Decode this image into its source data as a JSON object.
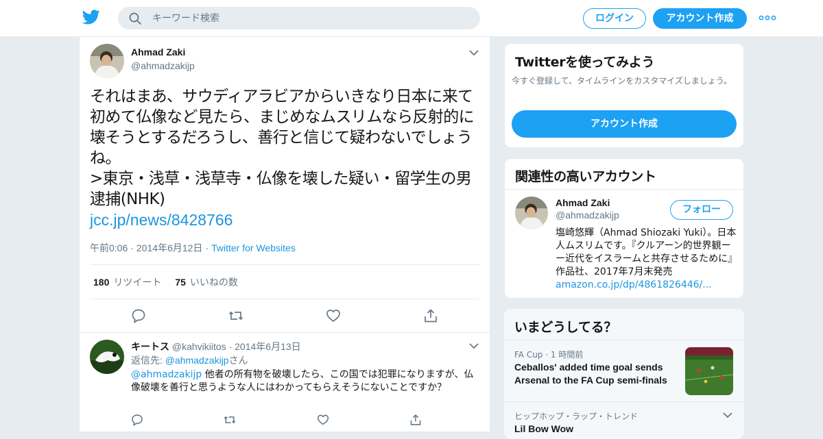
{
  "header": {
    "search_placeholder": "キーワード検索",
    "login_label": "ログイン",
    "signup_label": "アカウント作成"
  },
  "tweet": {
    "author_name": "Ahmad Zaki",
    "author_handle": "@ahmadzakijp",
    "text": "それはまあ、サウディアラビアからいきなり日本に来て初めて仏像など見たら、まじめなムスリムなら反射的に壊そうとするだろうし、善行と信じて疑わないでしょうね。\n>東京・浅草・浅草寺・仏像を壊した疑い・留学生の男逮捕(NHK)",
    "link": "jcc.jp/news/8428766",
    "time": "午前0:06",
    "date": "2014年6月12日",
    "source": "Twitter for Websites",
    "retweet_count": "180",
    "retweet_label": "リツイート",
    "like_count": "75",
    "like_label": "いいねの数"
  },
  "reply": {
    "author_name": "キートス",
    "author_handle": "@kahvikiitos",
    "date": "2014年6月13日",
    "reply_to_label": "返信先:",
    "reply_to_handle": "@ahmadzakijp",
    "reply_to_suffix": "さん",
    "mention": "@ahmadzakijp",
    "text": "他者の所有物を破壊したら、この国では犯罪になりますが、仏像破壊を善行と思うような人にはわかってもらえそうにないことですか？"
  },
  "signup_card": {
    "title": "Twitterを使ってみよう",
    "subtitle": "今すぐ登録して、タイムラインをカスタマイズしましょう。",
    "button_label": "アカウント作成"
  },
  "related_card": {
    "title": "関連性の高いアカウント",
    "name": "Ahmad Zaki",
    "handle": "@ahmadzakijp",
    "follow_label": "フォロー",
    "bio": "塩崎悠輝（Ahmad Shiozaki Yuki）。日本人ムスリムです。『クルアーン的世界観ーー近代をイスラームと共存させるために』作品社、2017年7月末発売",
    "bio_link": "amazon.co.jp/dp/4861826446/..."
  },
  "trends_card": {
    "title": "いまどうしてる？",
    "items": [
      {
        "category": "FA Cup",
        "time": "1 時間前",
        "headline": "Ceballos' added time goal sends Arsenal to the FA Cup semi-finals"
      },
      {
        "category": "ヒップホップ・ラップ・トレンド",
        "headline": "Lil Bow Wow"
      }
    ]
  },
  "colors": {
    "accent": "#1da1f2",
    "link": "#1b95e0",
    "muted": "#657786",
    "background": "#e6ecf0"
  }
}
